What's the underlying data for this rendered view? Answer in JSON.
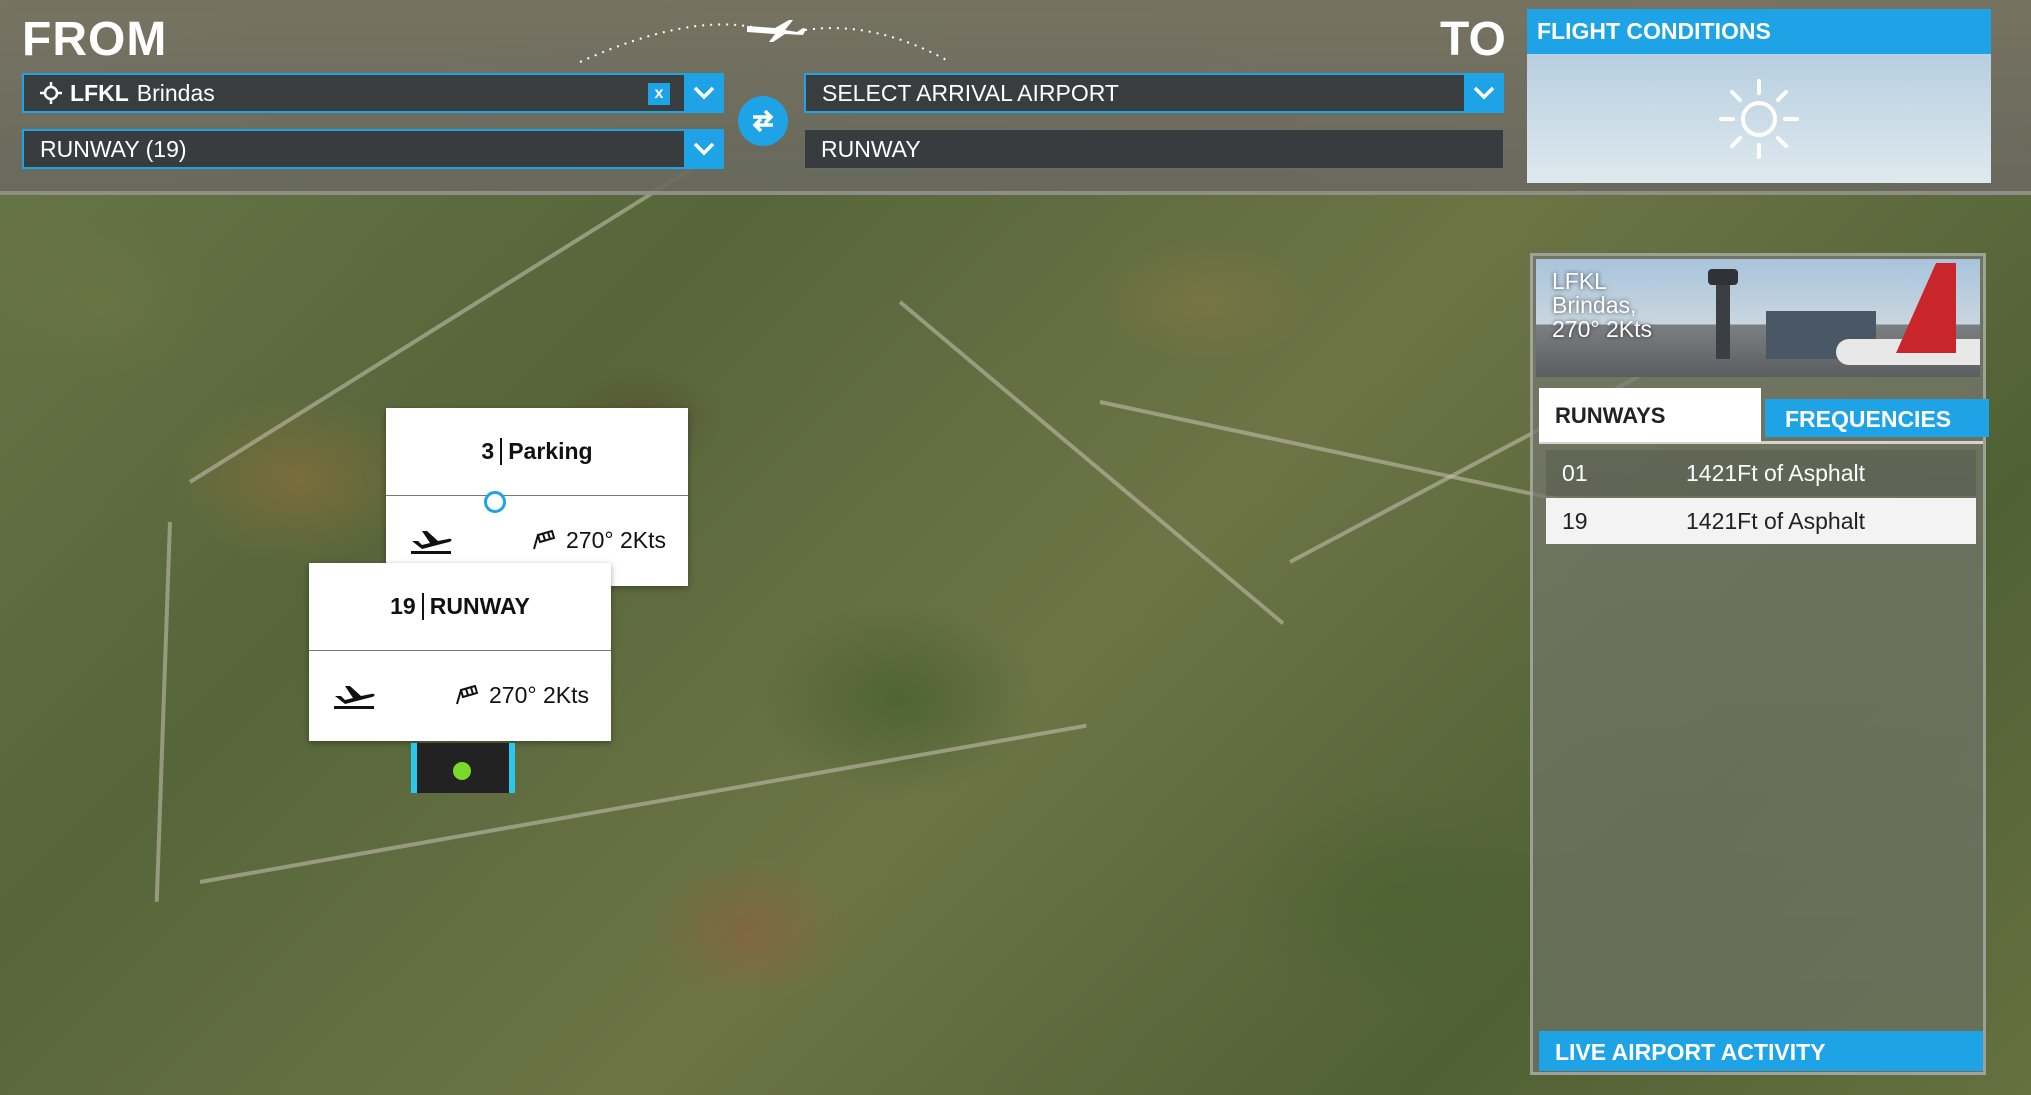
{
  "header": {
    "from_title": "FROM",
    "to_title": "TO",
    "departure": {
      "code": "LFKL",
      "name": "Brindas",
      "clear_label": "x",
      "runway_value": "RUNWAY (19)"
    },
    "arrival": {
      "placeholder": "SELECT ARRIVAL AIRPORT",
      "runway_value": "RUNWAY"
    }
  },
  "flight_conditions": {
    "title": "FLIGHT CONDITIONS",
    "weather_icon": "sun-icon"
  },
  "map": {
    "parking_popup": {
      "number": "3",
      "label": "Parking",
      "wind": "270° 2Kts"
    },
    "runway_popup": {
      "number": "19",
      "label": "RUNWAY",
      "wind": "270° 2Kts"
    }
  },
  "airport_panel": {
    "image_lines": [
      "LFKL",
      "Brindas,",
      "270° 2Kts"
    ],
    "tabs": [
      "RUNWAYS",
      "FREQUENCIES"
    ],
    "runways": [
      {
        "id": "01",
        "desc": "1421Ft of Asphalt"
      },
      {
        "id": "19",
        "desc": "1421Ft of Asphalt"
      }
    ],
    "live_activity_label": "LIVE AIRPORT ACTIVITY"
  },
  "colors": {
    "accent": "#1ea3e6",
    "marker_border": "#27c9ef",
    "marker_dot": "#7ad82b"
  }
}
